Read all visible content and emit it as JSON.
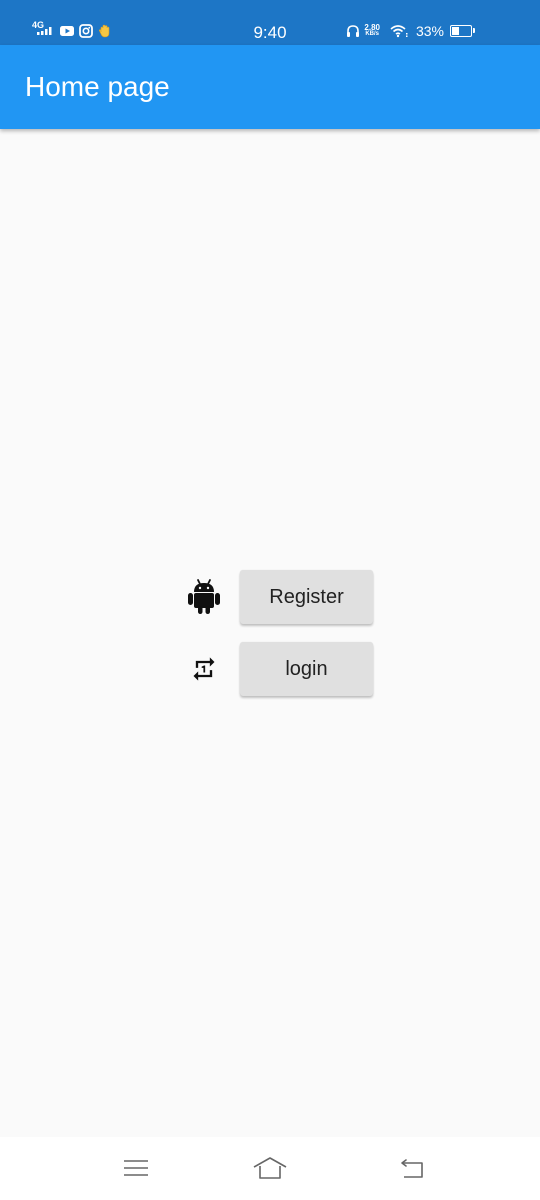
{
  "status_bar": {
    "network": "4G",
    "time": "9:40",
    "speed_value": "2.80",
    "speed_unit": "KB/s",
    "battery_percent": "33%",
    "battery_level": 0.33,
    "icons": [
      "signal-icon",
      "youtube-icon",
      "instagram-icon",
      "wave-hand-icon",
      "headphones-icon",
      "wifi-icon",
      "battery-icon"
    ]
  },
  "app_bar": {
    "title": "Home page",
    "color": "#2196f3"
  },
  "content": {
    "rows": [
      {
        "icon": "android-icon",
        "button_label": "Register"
      },
      {
        "icon": "repeat-one-icon",
        "button_label": "login"
      }
    ]
  },
  "nav_bar": {
    "icons": [
      "menu-icon",
      "home-icon",
      "back-icon"
    ]
  }
}
